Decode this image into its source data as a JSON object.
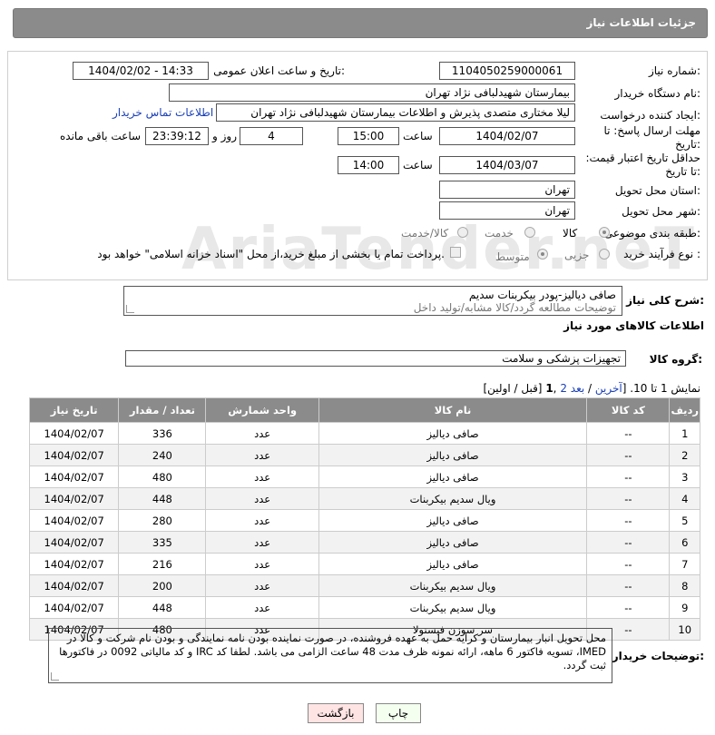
{
  "header": {
    "title": "جزئیات اطلاعات نیاز"
  },
  "fields": {
    "need_number_label": "شماره نیاز:",
    "need_number": "1104050259000061",
    "announce_label": "تاریخ و ساعت اعلان عمومی:",
    "announce_value": "1404/02/02 - 14:33",
    "buyer_org_label": "نام دستگاه خریدار:",
    "buyer_org": "بیمارستان شهیدلبافی نژاد تهران",
    "requester_label": "ایجاد کننده درخواست:",
    "requester": "لیلا مختاری متصدی پذیرش و اطلاعات بیمارستان شهیدلبافی نژاد تهران",
    "contact_link": "اطلاعات تماس خریدار",
    "deadline_label": "مهلت ارسال پاسخ: تا تاریخ:",
    "deadline_date": "1404/02/07",
    "time_label": "ساعت",
    "deadline_time": "15:00",
    "days_value": "4",
    "days_label": "روز و",
    "remaining_value": "23:39:12",
    "remaining_label": "ساعت باقی مانده",
    "price_validity_label": "حداقل تاریخ اعتبار قیمت: تا تاریخ:",
    "price_date": "1404/03/07",
    "price_time": "14:00",
    "province_label": "استان محل تحویل:",
    "province": "تهران",
    "city_label": "شهر محل تحویل:",
    "city": "تهران",
    "category_label": "طبقه بندی موضوعی:",
    "category_goods": "کالا",
    "category_service": "خدمت",
    "category_goods_service": "کالا/خدمت",
    "process_label": "نوع فرآیند خرید :",
    "process_minor": "جزیی",
    "process_medium": "متوسط",
    "payment_note": "پرداخت تمام یا بخشی از مبلغ خرید،از محل \"اسناد خزانه اسلامی\" خواهد بود."
  },
  "watermark": "AriaTender.neT",
  "description": {
    "label": "شرح کلی نیاز:",
    "line1": "صافی دیالیز-پودر بیکربنات سدیم",
    "line2": "توضیحات مطالعه گردد/کالا مشابه/تولید داخل"
  },
  "goods_section": {
    "title": "اطلاعات کالاهای مورد نیاز",
    "group_label": "گروه کالا:",
    "group_value": "تجهیزات پزشکی و سلامت"
  },
  "pagination": {
    "text_prefix": "نمایش 1 تا 10. [",
    "last": "آخرین",
    "sep1": " / ",
    "next": "بعد",
    "page2": "2",
    "sep2": " ,",
    "page1": "1",
    "text_suffix": " [قبل / اولین]"
  },
  "table": {
    "headers": [
      "ردیف",
      "کد کالا",
      "نام کالا",
      "واحد شمارش",
      "تعداد / مقدار",
      "تاریخ نیاز"
    ],
    "rows": [
      [
        "1",
        "--",
        "صافی دیالیز",
        "عدد",
        "336",
        "1404/02/07"
      ],
      [
        "2",
        "--",
        "صافی دیالیز",
        "عدد",
        "240",
        "1404/02/07"
      ],
      [
        "3",
        "--",
        "صافی دیالیز",
        "عدد",
        "480",
        "1404/02/07"
      ],
      [
        "4",
        "--",
        "ویال سدیم بیکربنات",
        "عدد",
        "448",
        "1404/02/07"
      ],
      [
        "5",
        "--",
        "صافی دیالیز",
        "عدد",
        "280",
        "1404/02/07"
      ],
      [
        "6",
        "--",
        "صافی دیالیز",
        "عدد",
        "335",
        "1404/02/07"
      ],
      [
        "7",
        "--",
        "صافی دیالیز",
        "عدد",
        "216",
        "1404/02/07"
      ],
      [
        "8",
        "--",
        "ویال سدیم بیکربنات",
        "عدد",
        "200",
        "1404/02/07"
      ],
      [
        "9",
        "--",
        "ویال سدیم بیکربنات",
        "عدد",
        "448",
        "1404/02/07"
      ],
      [
        "10",
        "--",
        "سر سوزن فیستولا",
        "عدد",
        "480",
        "1404/02/07"
      ]
    ]
  },
  "buyer_notes": {
    "label": "توضیحات خریدار:",
    "text": "محل تحویل انبار بیمارستان و کرایه حمل به عهده فروشنده، در صورت نماینده بودن نامه نمایندگی و بودن نام شرکت و کالا در IMED، تسویه فاکتور 6 ماهه، ارائه نمونه ظرف مدت 48 ساعت الزامی می باشد. لطفا کد IRC و کد مالیاتی 0092 در فاکتورها ثبت گردد."
  },
  "buttons": {
    "print": "چاپ",
    "back": "بازگشت"
  }
}
